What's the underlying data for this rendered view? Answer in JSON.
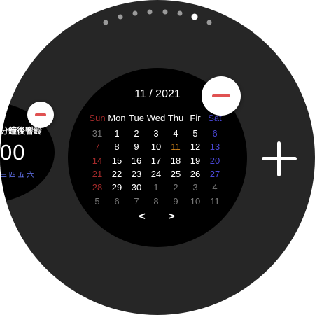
{
  "pager": {
    "dot_count": 8,
    "active_index": 6
  },
  "left_tile": {
    "title": "分鐘後響鈴",
    "time": "00",
    "days": "三 四 五 六"
  },
  "calendar": {
    "title": "11 / 2021",
    "weekdays": [
      "Sun",
      "Mon",
      "Tue",
      "Wed",
      "Thu",
      "Fir",
      "Sat"
    ],
    "weeks": [
      [
        "31",
        "1",
        "2",
        "3",
        "4",
        "5",
        "6"
      ],
      [
        "7",
        "8",
        "9",
        "10",
        "11",
        "12",
        "13"
      ],
      [
        "14",
        "15",
        "16",
        "17",
        "18",
        "19",
        "20"
      ],
      [
        "21",
        "22",
        "23",
        "24",
        "25",
        "26",
        "27"
      ],
      [
        "28",
        "29",
        "30",
        "1",
        "2",
        "3",
        "4"
      ],
      [
        "5",
        "6",
        "7",
        "8",
        "9",
        "10",
        "11"
      ]
    ],
    "today": "11",
    "prev_label": "<",
    "next_label": ">"
  },
  "colors": {
    "watch_bg": "#262626",
    "sunday": "#a42a2a",
    "saturday": "#4a47d6",
    "today": "#c07a1a",
    "remove_red": "#e05252"
  },
  "icons": {
    "remove": "minus-icon",
    "add": "plus-icon"
  }
}
